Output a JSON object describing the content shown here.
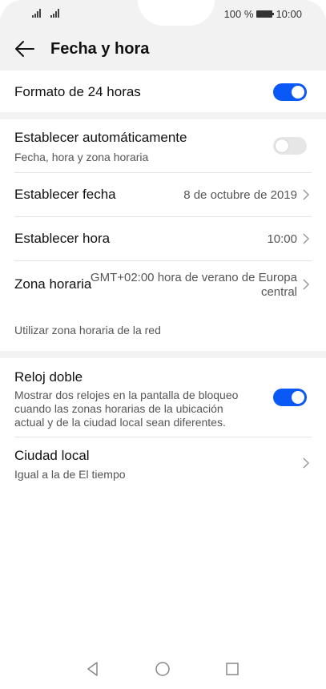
{
  "status_bar": {
    "battery_text": "100 %",
    "time": "10:00"
  },
  "header": {
    "title": "Fecha y hora"
  },
  "settings": {
    "format24": {
      "label": "Formato de 24 horas",
      "enabled": true
    },
    "auto": {
      "label": "Establecer automáticamente",
      "sublabel": "Fecha, hora y zona horaria",
      "enabled": false
    },
    "set_date": {
      "label": "Establecer fecha",
      "value": "8 de octubre de 2019"
    },
    "set_time": {
      "label": "Establecer hora",
      "value": "10:00"
    },
    "timezone": {
      "label": "Zona horaria",
      "value_line1": "GMT+02:00 hora de verano de Europa",
      "value_line2": "central"
    },
    "network_tz_note": "Utilizar zona horaria de la red",
    "dual_clock": {
      "label": "Reloj doble",
      "desc_line1": "Mostrar dos relojes en la pantalla de bloqueo",
      "desc_line2": "cuando las zonas horarias de la ubicación",
      "desc_line3": "actual y de la ciudad local sean diferentes.",
      "enabled": true
    },
    "home_city": {
      "label": "Ciudad local",
      "sublabel": "Igual a la de El tiempo"
    }
  },
  "colors": {
    "accent": "#0a59f7",
    "band": "#f2f2f2"
  }
}
